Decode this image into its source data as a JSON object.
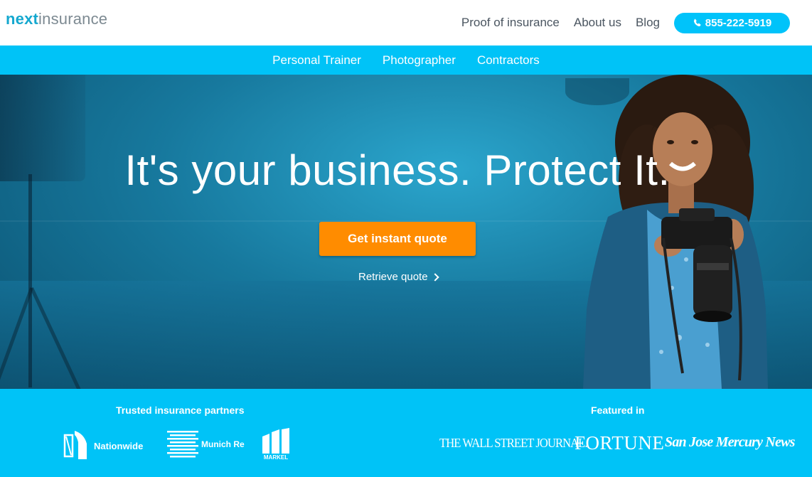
{
  "brand": {
    "logo_part1": "next",
    "logo_part2": "insurance"
  },
  "top_nav": {
    "items": [
      {
        "label": "Proof of insurance"
      },
      {
        "label": "About us"
      },
      {
        "label": "Blog"
      }
    ],
    "phone": "855-222-5919"
  },
  "sub_nav": {
    "items": [
      {
        "label": "Personal Trainer"
      },
      {
        "label": "Photographer"
      },
      {
        "label": "Contractors"
      }
    ]
  },
  "hero": {
    "title": "It's your business. Protect It.",
    "cta_label": "Get instant quote",
    "retrieve_label": "Retrieve quote"
  },
  "partners": {
    "heading": "Trusted insurance partners",
    "items": [
      {
        "name": "Nationwide",
        "icon": "nationwide-logo-icon"
      },
      {
        "name": "Munich Re",
        "icon": "munich-re-logo-icon"
      },
      {
        "name": "MARKEL",
        "icon": "markel-logo-icon"
      }
    ]
  },
  "press": {
    "heading": "Featured in",
    "items": [
      {
        "name": "THE WALL STREET JOURNAL."
      },
      {
        "name": "FORTUNE"
      },
      {
        "name": "San Jose Mercury News"
      }
    ]
  },
  "colors": {
    "brand_blue": "#00c3f7",
    "cta_orange": "#ff8c00",
    "logo_blue": "#15a8cf",
    "nav_text": "#4a5560"
  }
}
